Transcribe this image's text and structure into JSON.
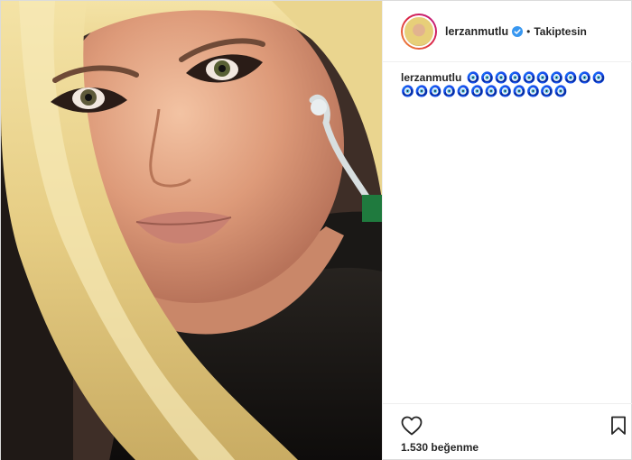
{
  "post": {
    "image_alt": "Selfie photo of a woman with long blonde hair and dramatic eye makeup",
    "username": "lerzanmutlu",
    "verified": true,
    "separator": "•",
    "follow_status": "Takiptesin",
    "caption": {
      "username": "lerzanmutlu",
      "text": "🧿🧿🧿🧿🧿🧿🧿🧿🧿🧿🧿🧿🧿🧿🧿🧿🧿🧿🧿🧿🧿🧿"
    },
    "likes_text": "1.530 beğenme"
  },
  "icons": {
    "like": "heart-outline-icon",
    "save": "bookmark-outline-icon",
    "verified": "verified-badge-icon"
  },
  "colors": {
    "verified_blue": "#3897f0",
    "border": "#dbdbdb",
    "text": "#262626"
  }
}
